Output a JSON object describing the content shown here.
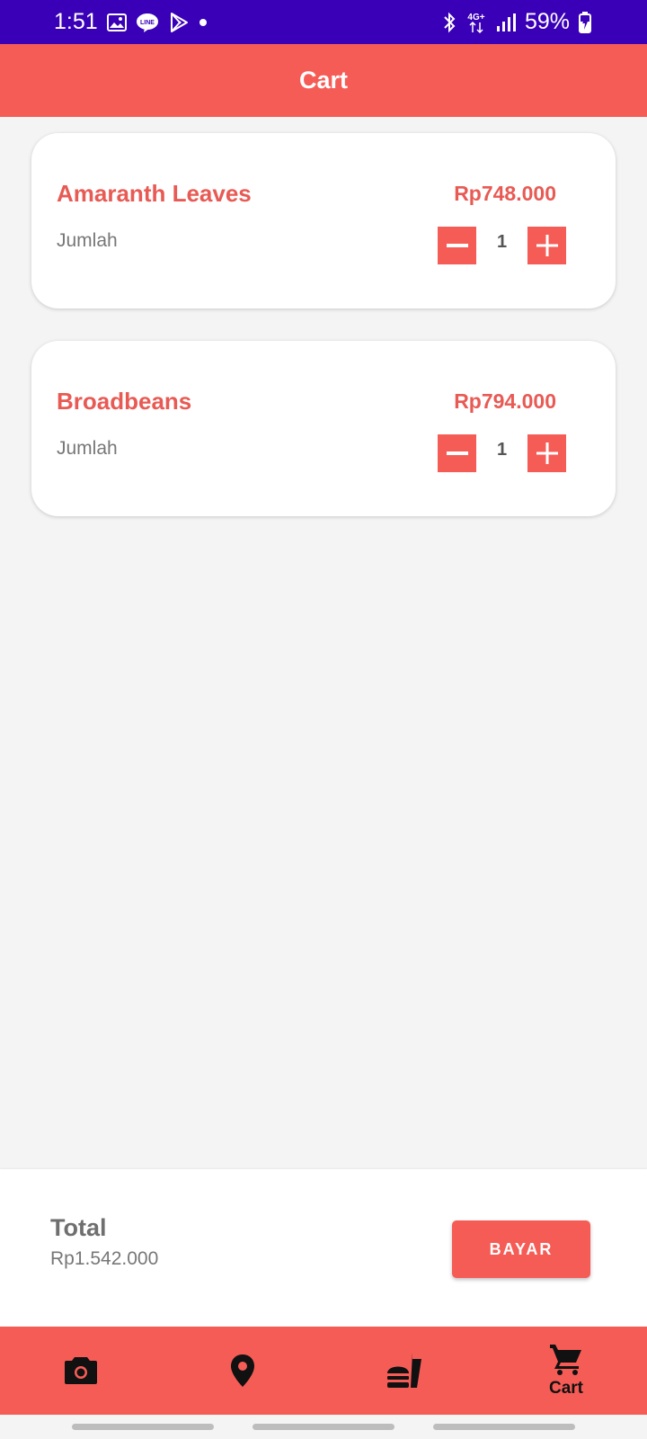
{
  "status_bar": {
    "time": "1:51",
    "network": "4G+",
    "battery": "59%"
  },
  "app_bar": {
    "title": "Cart"
  },
  "cart": {
    "items": [
      {
        "name": "Amaranth Leaves",
        "price": "Rp748.000",
        "qty_label": "Jumlah",
        "qty": "1"
      },
      {
        "name": "Broadbeans",
        "price": "Rp794.000",
        "qty_label": "Jumlah",
        "qty": "1"
      }
    ]
  },
  "checkout": {
    "total_label": "Total",
    "total_value": "Rp1.542.000",
    "pay_label": "BAYAR"
  },
  "bottom_nav": {
    "items": [
      {
        "icon": "camera-icon"
      },
      {
        "icon": "location-pin-icon"
      },
      {
        "icon": "fastfood-icon"
      },
      {
        "icon": "cart-icon",
        "label": "Cart"
      }
    ]
  },
  "colors": {
    "status_bar": "#3a00b8",
    "accent": "#f65c56",
    "accent_text": "#e85a54",
    "background": "#f4f4f4"
  }
}
